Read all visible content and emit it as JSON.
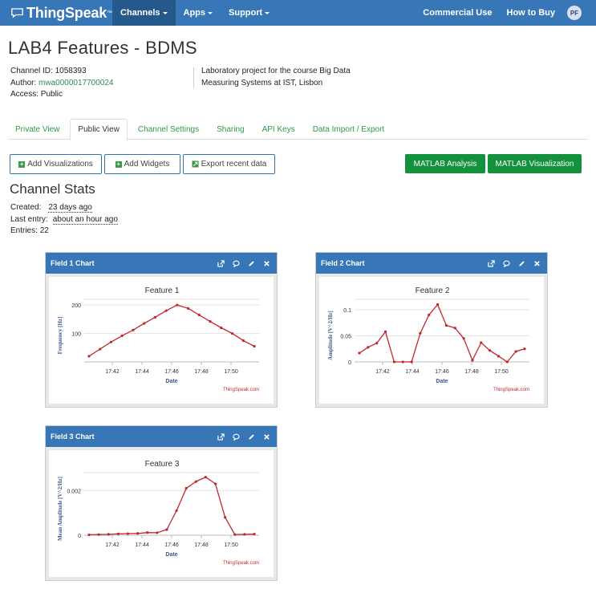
{
  "nav": {
    "brand": "ThingSpeak",
    "brand_tm": "™",
    "items": [
      {
        "label": "Channels"
      },
      {
        "label": "Apps"
      },
      {
        "label": "Support"
      }
    ],
    "right": [
      "Commercial Use",
      "How to Buy"
    ],
    "avatar": "PF"
  },
  "channel": {
    "title": "LAB4 Features - BDMS",
    "id_label": "Channel ID:",
    "id": "1058393",
    "author_label": "Author:",
    "author": "mwa0000017700024",
    "access_label": "Access:",
    "access": "Public",
    "description_line1": "Laboratory project for the course Big Data",
    "description_line2": "Measuring Systems at IST, Lisbon"
  },
  "tabs": [
    "Private View",
    "Public View",
    "Channel Settings",
    "Sharing",
    "API Keys",
    "Data Import / Export"
  ],
  "buttons": {
    "add_visualizations": "Add Visualizations",
    "add_widgets": "Add Widgets",
    "export": "Export recent data",
    "matlab_analysis": "MATLAB Analysis",
    "matlab_visualization": "MATLAB Visualization"
  },
  "stats": {
    "title": "Channel Stats",
    "created_label": "Created:",
    "created": "23 days ago",
    "last_label": "Last entry:",
    "last": "about an hour ago",
    "entries_label": "Entries:",
    "entries": "22"
  },
  "colors": {
    "nav": "#3877b7",
    "line": "#c0272d",
    "green": "#13913c"
  },
  "chart_data": [
    {
      "type": "line",
      "card_title": "Field 1 Chart",
      "title": "Feature 1",
      "xlabel": "Date",
      "ylabel": "Frequency [Hz]",
      "credit": "ThingSpeak.com",
      "x_ticks": [
        "17:42",
        "17:44",
        "17:46",
        "17:48",
        "17:50"
      ],
      "x_tick_values": [
        2,
        4,
        6,
        8,
        10
      ],
      "xlim": [
        0.4,
        11.7
      ],
      "ylim": [
        0,
        220
      ],
      "y_ticks": [
        100,
        200
      ],
      "x": [
        0.6,
        1.6,
        2.5,
        3.4,
        4.3,
        5.2,
        6.1,
        6.7,
        7.6,
        8.5,
        9.4,
        10.2,
        11.0,
        11.6,
        12.7,
        13.5
      ],
      "values": [
        20,
        45,
        70,
        92,
        112,
        135,
        157,
        180,
        200,
        188,
        165,
        142,
        120,
        100,
        75,
        55
      ]
    },
    {
      "type": "line",
      "card_title": "Field 2 Chart",
      "title": "Feature 2",
      "xlabel": "Date",
      "ylabel": "Amplitude [V^2/Hz]",
      "credit": "ThingSpeak.com",
      "x_ticks": [
        "17:42",
        "17:44",
        "17:46",
        "17:48",
        "17:50"
      ],
      "ylim": [
        0,
        0.12
      ],
      "y_ticks": [
        0,
        0.05,
        0.1
      ],
      "values": [
        0.017,
        0.028,
        0.036,
        0.058,
        0.0,
        0.0,
        0.0,
        0.055,
        0.09,
        0.11,
        0.07,
        0.065,
        0.045,
        0.003,
        0.037,
        0.022,
        0.011,
        0.0,
        0.02,
        0.025
      ]
    },
    {
      "type": "line",
      "card_title": "Field 3 Chart",
      "title": "Feature 3",
      "xlabel": "Date",
      "ylabel": "Mean Amplitude [V^2/Hz]",
      "credit": "ThingSpeak.com",
      "x_ticks": [
        "17:42",
        "17:44",
        "17:46",
        "17:48",
        "17:50"
      ],
      "ylim": [
        0,
        0.0028
      ],
      "y_ticks": [
        0,
        0.002
      ],
      "values": [
        2e-05,
        3e-05,
        4e-05,
        6e-05,
        7e-05,
        8e-05,
        0.00012,
        0.00011,
        0.00025,
        0.0011,
        0.0021,
        0.0024,
        0.0026,
        0.0023,
        0.0008,
        3e-05,
        4e-05,
        5e-05
      ]
    }
  ]
}
